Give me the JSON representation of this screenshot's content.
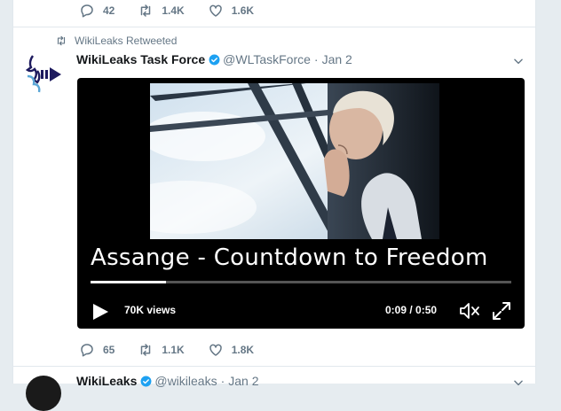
{
  "colors": {
    "accent": "#1da1f2",
    "muted": "#657786",
    "text": "#14171a",
    "brand_navy": "#1d1a5e"
  },
  "prev_tweet": {
    "actions": [
      {
        "icon": "reply-icon",
        "count": "42"
      },
      {
        "icon": "retweet-icon",
        "count": "1.4K"
      },
      {
        "icon": "like-icon",
        "count": "1.6K"
      }
    ]
  },
  "tweet": {
    "context": "WikiLeaks Retweeted",
    "fullname": "WikiLeaks Task Force",
    "handle": "@WLTaskForce",
    "separator": "·",
    "date": "Jan 2",
    "video": {
      "title": "Assange - Countdown to Freedom",
      "views": "70K views",
      "time": "0:09 / 0:50",
      "progress": 0.18
    },
    "actions": [
      {
        "icon": "reply-icon",
        "count": "65"
      },
      {
        "icon": "retweet-icon",
        "count": "1.1K"
      },
      {
        "icon": "like-icon",
        "count": "1.8K"
      }
    ]
  },
  "next_tweet": {
    "fullname": "WikiLeaks",
    "handle": "@wikileaks",
    "separator": "·",
    "date": "Jan 2"
  }
}
